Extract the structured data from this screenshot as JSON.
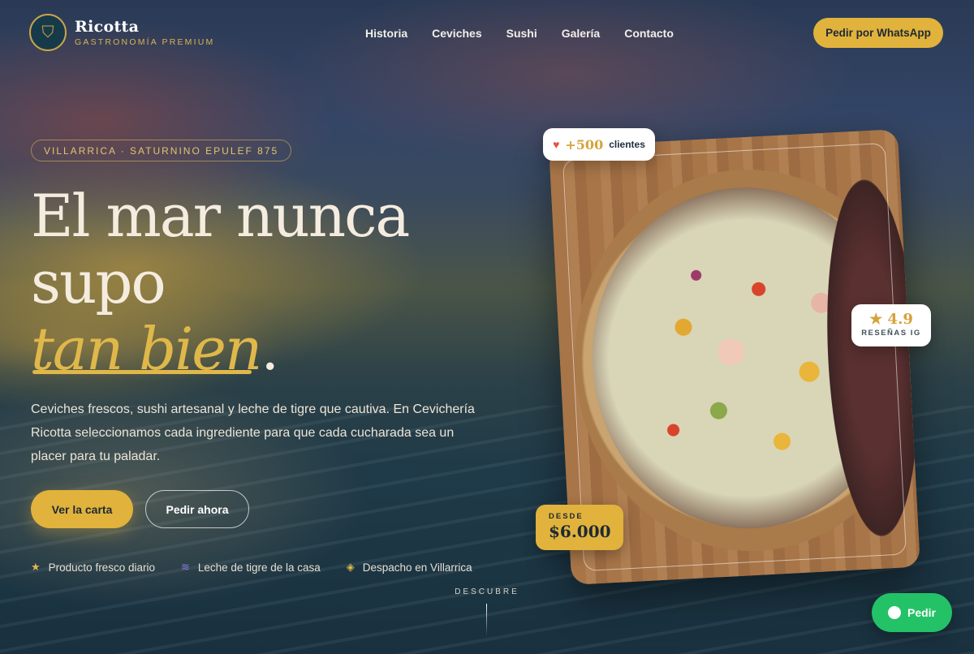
{
  "header": {
    "logo_icon": "wolf-emblem-icon",
    "brand_name": "Ricotta",
    "brand_sub": "GASTRONOMÍA PREMIUM",
    "nav": [
      "Historia",
      "Ceviches",
      "Sushi",
      "Galería",
      "Contacto"
    ],
    "cta": "Pedir por WhatsApp"
  },
  "hero": {
    "location": "VILLARRICA · SATURNINO EPULEF 875",
    "title_line1": "El mar nunca",
    "title_line2": "supo",
    "title_italic": "tan bien",
    "title_dot": ".",
    "description": "Ceviches frescos, sushi artesanal y leche de tigre que cautiva. En Cevichería Ricotta seleccionamos cada ingrediente para que cada cucharada sea un placer para tu paladar.",
    "primary_button": "Ver la carta",
    "secondary_button": "Pedir ahora",
    "features": [
      {
        "icon": "star-icon",
        "glyph": "★",
        "color": "#e0b84a",
        "label": "Producto fresco diario"
      },
      {
        "icon": "waves-icon",
        "glyph": "≋",
        "color": "#8f7ae6",
        "label": "Leche de tigre de la casa"
      },
      {
        "icon": "diamond-icon",
        "glyph": "◈",
        "color": "#e0b84a",
        "label": "Despacho en Villarrica"
      }
    ],
    "discover": "DESCUBRE"
  },
  "card": {
    "clients_count": "+500",
    "clients_label": "clientes",
    "rating": "★ 4.9",
    "rating_label": "RESEÑAS IG",
    "price_label": "DESDE",
    "price_value": "$6.000"
  },
  "float_button": "Pedir",
  "colors": {
    "accent": "#e1b23c",
    "whatsapp": "#23c266"
  }
}
